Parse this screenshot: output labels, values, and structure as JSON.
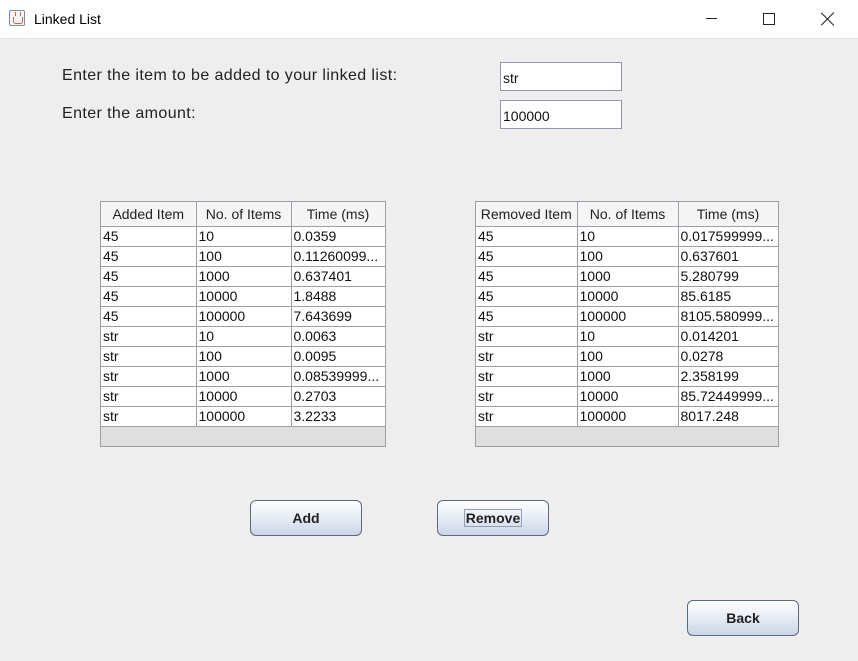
{
  "window": {
    "title": "Linked List",
    "icon": "java-cup-icon"
  },
  "form": {
    "item_label": "Enter the item to be added to your linked list:",
    "item_value": "str",
    "amount_label": "Enter the amount:",
    "amount_value": "100000"
  },
  "added_table": {
    "columns": [
      "Added Item",
      "No. of Items",
      "Time (ms)"
    ],
    "rows": [
      [
        "45",
        "10",
        "0.0359"
      ],
      [
        "45",
        "100",
        "0.11260099..."
      ],
      [
        "45",
        "1000",
        "0.637401"
      ],
      [
        "45",
        "10000",
        "1.8488"
      ],
      [
        "45",
        "100000",
        "7.643699"
      ],
      [
        "str",
        "10",
        "0.0063"
      ],
      [
        "str",
        "100",
        "0.0095"
      ],
      [
        "str",
        "1000",
        "0.08539999..."
      ],
      [
        "str",
        "10000",
        "0.2703"
      ],
      [
        "str",
        "100000",
        "3.2233"
      ]
    ]
  },
  "removed_table": {
    "columns": [
      "Removed Item",
      "No. of Items",
      "Time (ms)"
    ],
    "rows": [
      [
        "45",
        "10",
        "0.017599999..."
      ],
      [
        "45",
        "100",
        "0.637601"
      ],
      [
        "45",
        "1000",
        "5.280799"
      ],
      [
        "45",
        "10000",
        "85.6185"
      ],
      [
        "45",
        "100000",
        "8105.580999..."
      ],
      [
        "str",
        "10",
        "0.014201"
      ],
      [
        "str",
        "100",
        "0.0278"
      ],
      [
        "str",
        "1000",
        "2.358199"
      ],
      [
        "str",
        "10000",
        "85.72449999..."
      ],
      [
        "str",
        "100000",
        "8017.248"
      ]
    ]
  },
  "buttons": {
    "add": "Add",
    "remove": "Remove",
    "back": "Back"
  }
}
